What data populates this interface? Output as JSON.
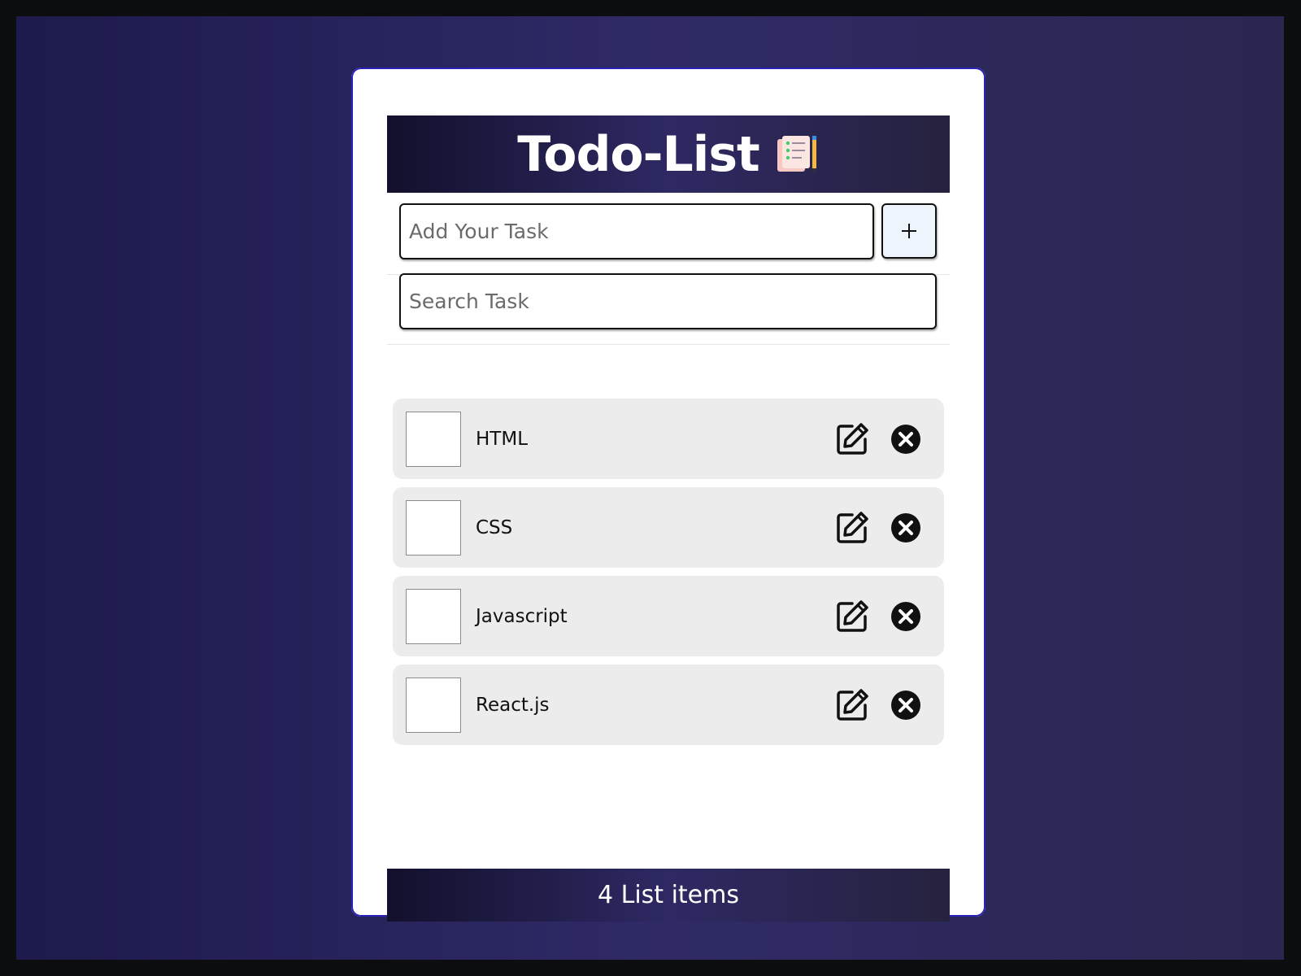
{
  "app": {
    "title": "Todo-List",
    "title_icon": "notepad-pencil-icon"
  },
  "add_task": {
    "placeholder": "Add Your Task",
    "value": "",
    "button_label": "+"
  },
  "search": {
    "placeholder": "Search Task",
    "value": ""
  },
  "tasks": [
    {
      "label": "HTML",
      "done": false
    },
    {
      "label": "CSS",
      "done": false
    },
    {
      "label": "Javascript",
      "done": false
    },
    {
      "label": "React.js",
      "done": false
    }
  ],
  "footer": {
    "count_text": "4 List items"
  },
  "icons": {
    "edit": "edit-icon",
    "delete": "close-circle-icon"
  },
  "colors": {
    "banner_dark": "#12102c",
    "banner_mid": "#2e2963",
    "background": "#2f2a66",
    "item_bg": "#ececec"
  }
}
